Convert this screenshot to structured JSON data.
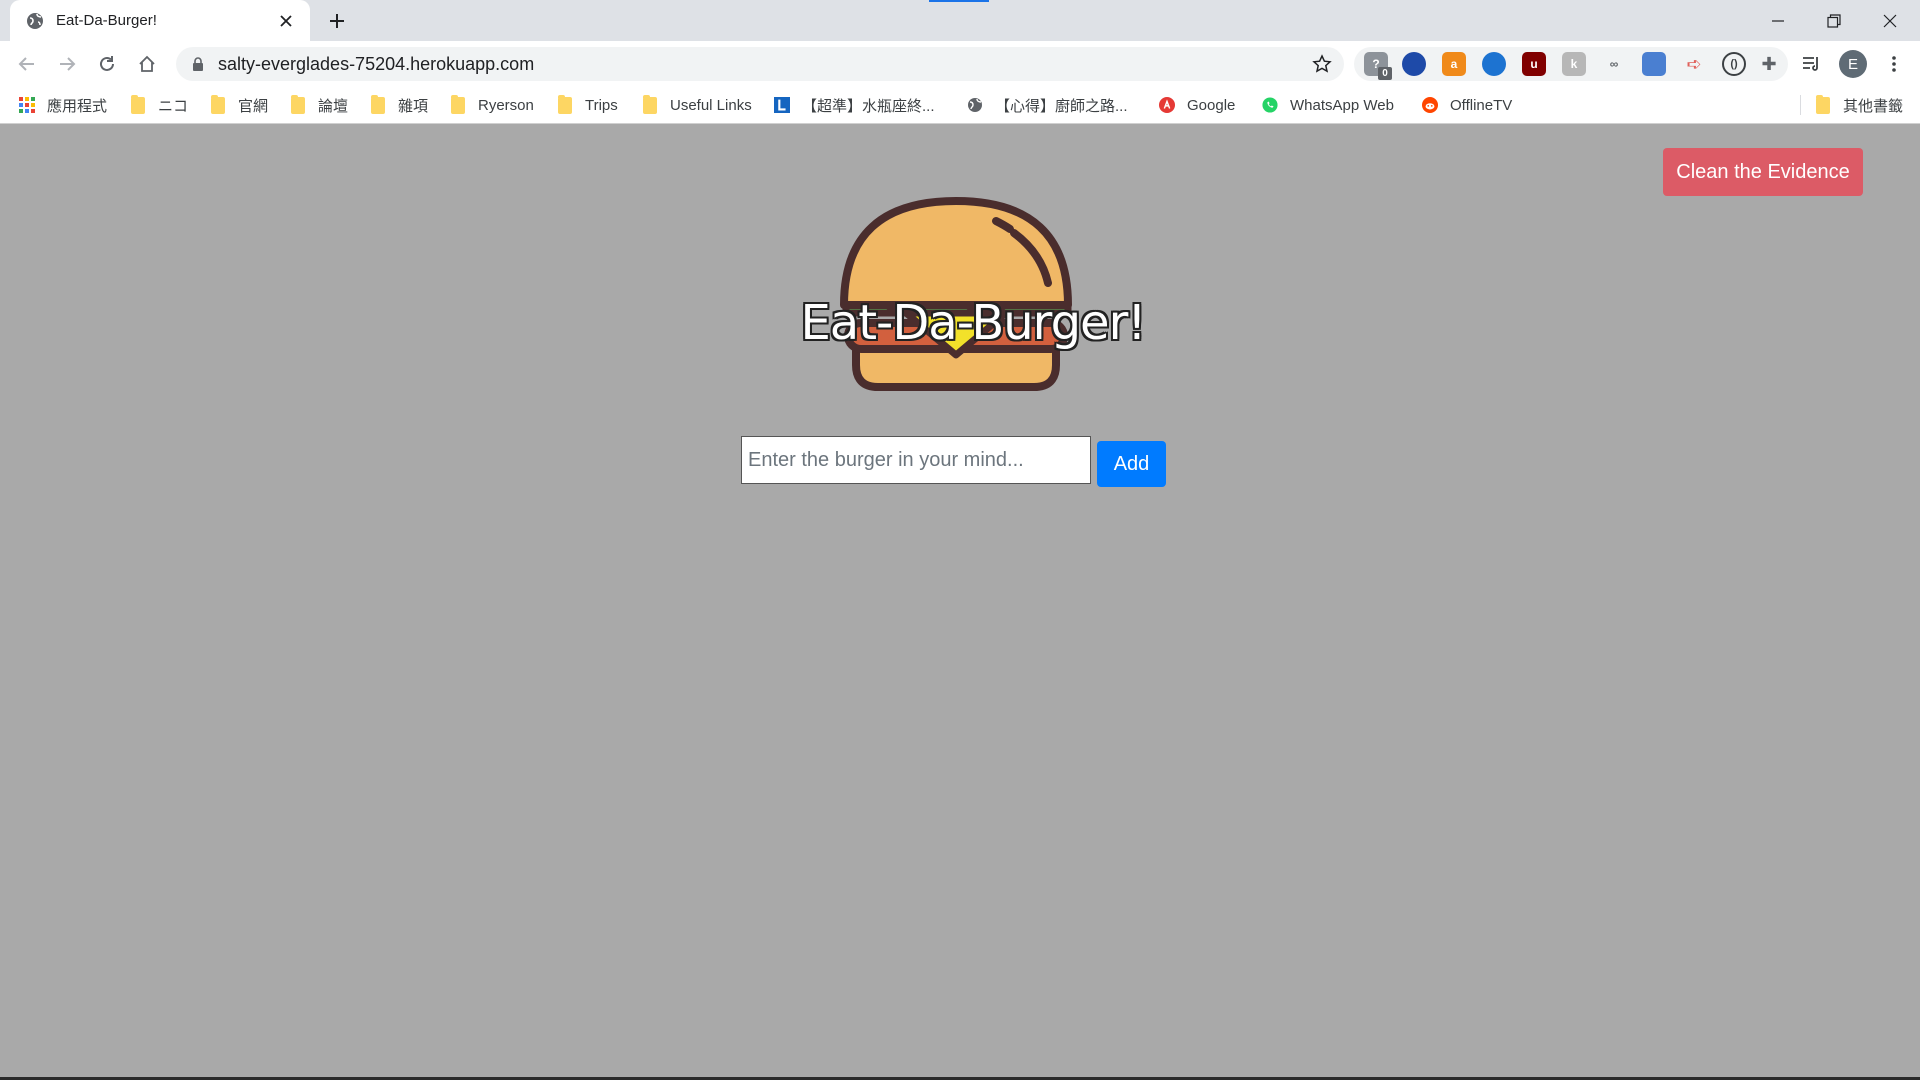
{
  "browser": {
    "tab_title": "Eat-Da-Burger!",
    "url": "salty-everglades-75204.herokuapp.com",
    "avatar_letter": "E",
    "extension_badge": "0"
  },
  "bookmarks": [
    {
      "label": "應用程式",
      "icon": "apps-grid-icon"
    },
    {
      "label": "ニコ",
      "icon": "folder-icon"
    },
    {
      "label": "官網",
      "icon": "folder-icon"
    },
    {
      "label": "論壇",
      "icon": "folder-icon"
    },
    {
      "label": "雜項",
      "icon": "folder-icon"
    },
    {
      "label": "Ryerson",
      "icon": "folder-icon"
    },
    {
      "label": "Trips",
      "icon": "folder-icon"
    },
    {
      "label": "Useful Links",
      "icon": "folder-icon"
    },
    {
      "label": "【超準】水瓶座終...",
      "icon": "l-logo-icon"
    },
    {
      "label": "【心得】廚師之路...",
      "icon": "globe-icon"
    },
    {
      "label": "Google",
      "icon": "google-icon"
    },
    {
      "label": "WhatsApp Web",
      "icon": "whatsapp-icon"
    },
    {
      "label": "OfflineTV",
      "icon": "reddit-icon"
    },
    {
      "label": "其他書籤",
      "icon": "folder-icon"
    }
  ],
  "page": {
    "title": "Eat-Da-Burger!",
    "clean_button": "Clean the Evidence",
    "input_placeholder": "Enter the burger in your mind...",
    "add_button": "Add"
  },
  "colors": {
    "page_background": "#a9a9a9",
    "clean_button": "#dc5b66",
    "add_button": "#007bff",
    "bun": "#f0b866",
    "lettuce": "#5cb85c",
    "cheese": "#f2e12a",
    "patty": "#d2603e"
  }
}
